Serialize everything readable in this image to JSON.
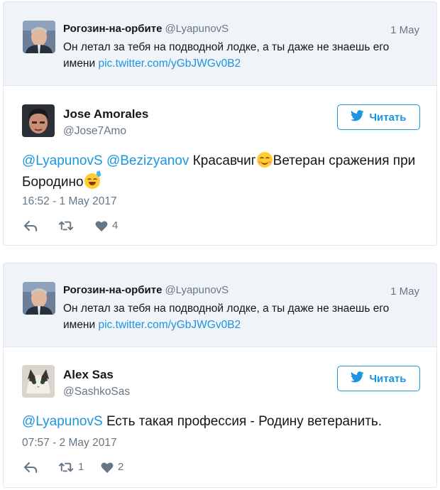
{
  "cards": [
    {
      "quoted": {
        "name": "Рогозин-на-орбите",
        "handle": "@LyapunovS",
        "date": "1 May",
        "text": "Он летал за тебя на подводной лодке, а ты даже не знаешь его имени",
        "link": "pic.twitter.com/yGbJWGv0B2"
      },
      "tweet": {
        "name": "Jose Amorales",
        "handle": "@Jose7Amo",
        "follow_label": "Читать",
        "mention1": "@LyapunovS",
        "mention2": "@Bezizyanov",
        "text_part1": "Красавчиг",
        "text_part2": "Ветеран сражения при Бородино",
        "timestamp": "16:52 - 1 May 2017",
        "retweets": "",
        "likes": "4"
      }
    },
    {
      "quoted": {
        "name": "Рогозин-на-орбите",
        "handle": "@LyapunovS",
        "date": "1 May",
        "text": "Он летал за тебя на подводной лодке, а ты даже не знаешь его имени",
        "link": "pic.twitter.com/yGbJWGv0B2"
      },
      "tweet": {
        "name": "Alex Sas",
        "handle": "@SashkoSas",
        "follow_label": "Читать",
        "mention1": "@LyapunovS",
        "text": "Есть такая профессия - Родину ветеранить.",
        "timestamp": "07:57 - 2 May 2017",
        "retweets": "1",
        "likes": "2"
      }
    }
  ],
  "icons": {
    "reply": "reply-icon",
    "retweet": "retweet-icon",
    "like": "heart-icon",
    "bird": "twitter-bird-icon"
  },
  "colors": {
    "link": "#1b95e0",
    "muted": "#657786",
    "quoted_bg": "#f0f4f9",
    "border": "#e1e8ed"
  }
}
